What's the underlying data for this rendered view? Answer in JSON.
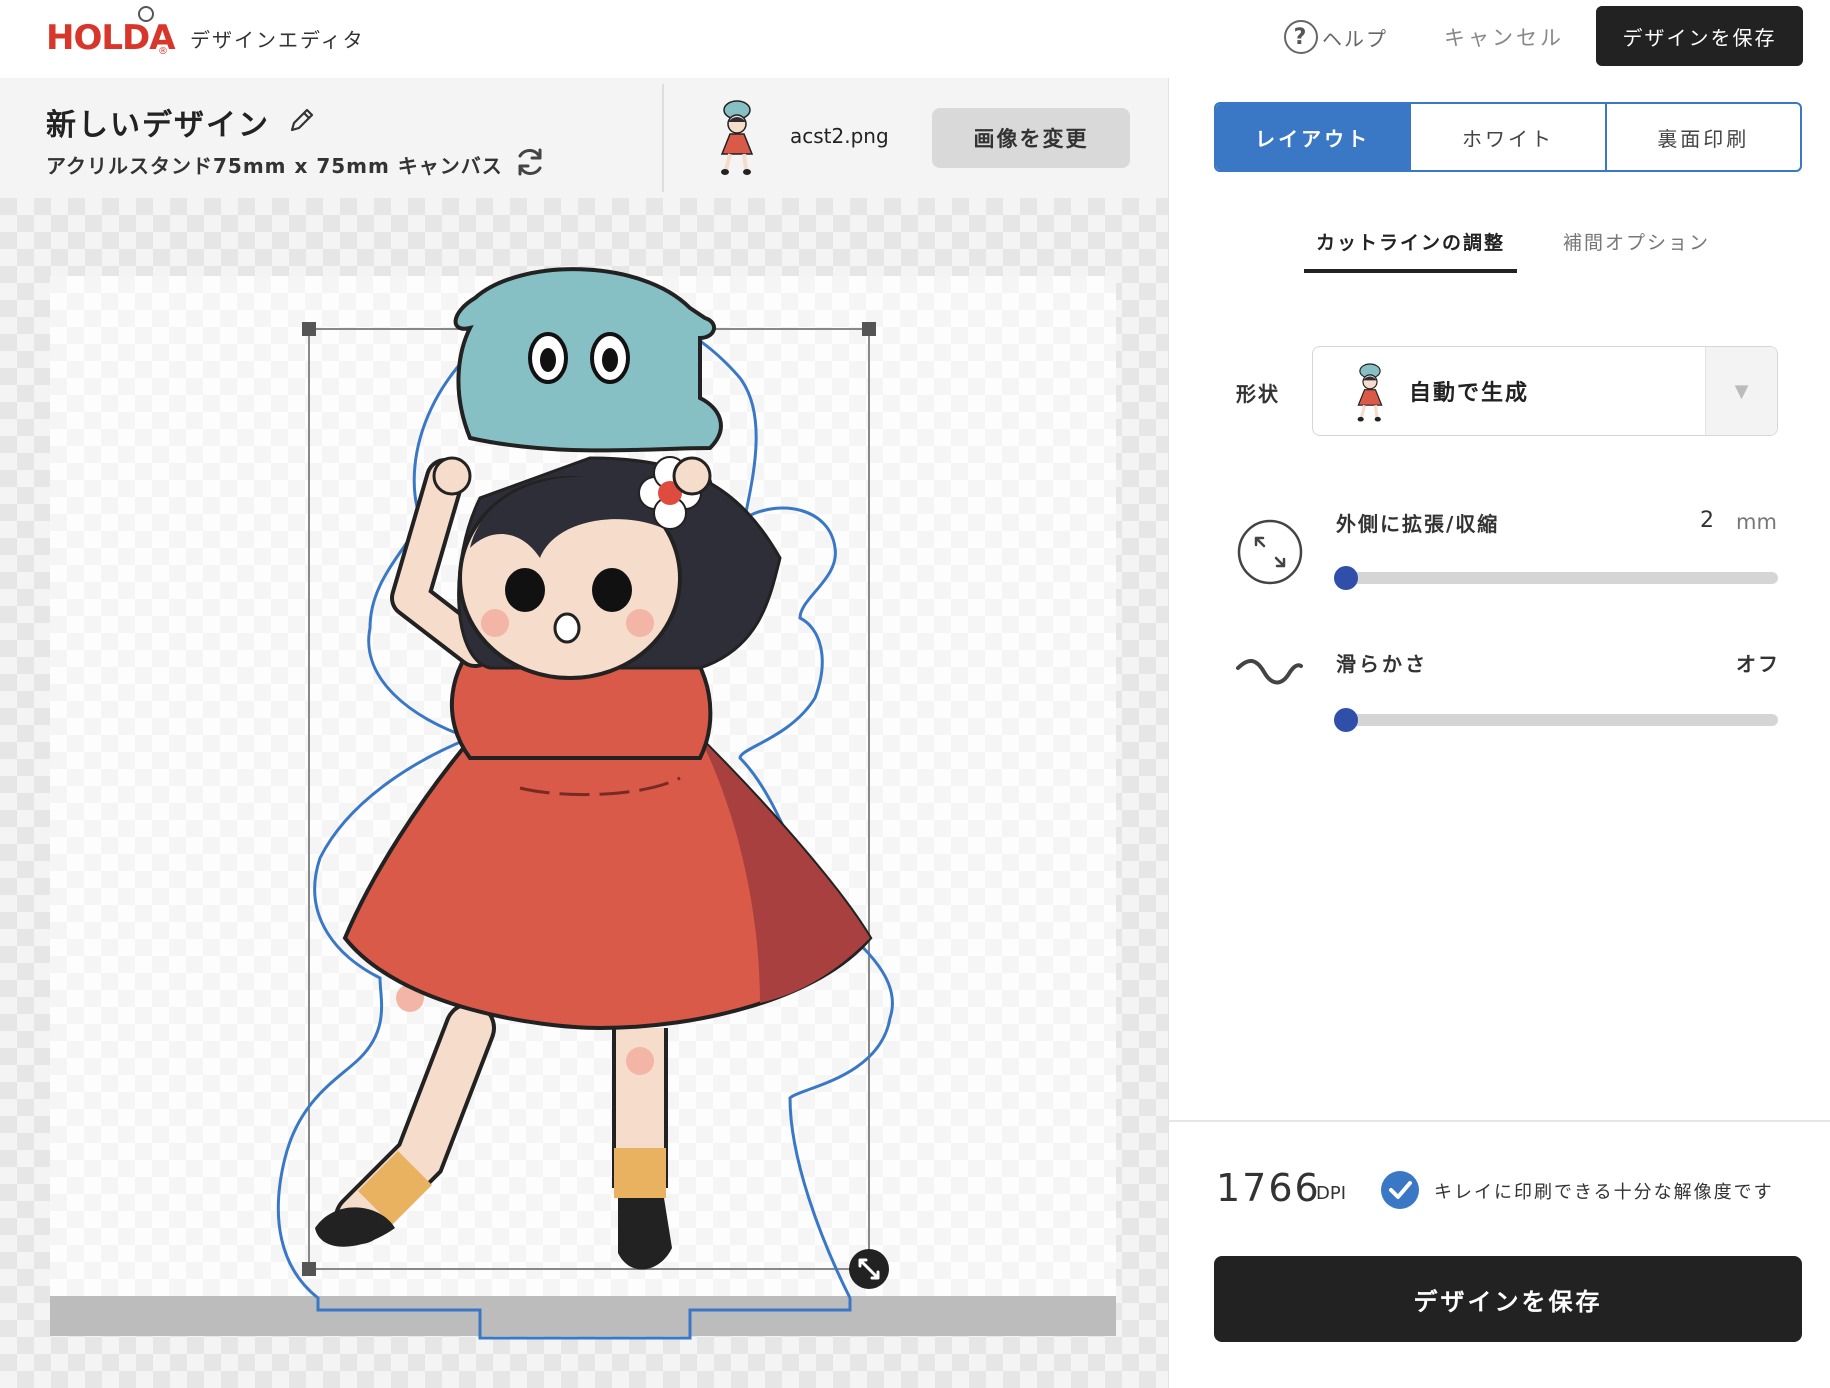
{
  "app": {
    "logo": "HOLDA",
    "subtitle": "デザインエディタ"
  },
  "topbar": {
    "help_label": "ヘルプ",
    "cancel_label": "キャンセル",
    "save_label": "デザインを保存"
  },
  "design": {
    "title": "新しいデザイン",
    "canvas_spec": "アクリルスタンド75mm x 75mm キャンバス",
    "file_name": "acst2.png",
    "change_image_label": "画像を変更"
  },
  "tabs": [
    {
      "label": "レイアウト",
      "active": true
    },
    {
      "label": "ホワイト",
      "active": false
    },
    {
      "label": "裏面印刷",
      "active": false
    }
  ],
  "subtabs": [
    {
      "label": "カットラインの調整",
      "active": true
    },
    {
      "label": "補間オプション",
      "active": false
    }
  ],
  "shape": {
    "label": "形状",
    "value": "自動で生成"
  },
  "expand": {
    "label": "外側に拡張/収縮",
    "value": "2",
    "unit": "mm",
    "slider_fraction": 0.0
  },
  "smoothness": {
    "label": "滑らかさ",
    "value": "オフ",
    "slider_fraction": 0.0
  },
  "resolution": {
    "dpi": "1766",
    "unit": "DPI",
    "message": "キレイに印刷できる十分な解像度です"
  },
  "footer": {
    "save_label": "デザインを保存"
  },
  "colors": {
    "accent": "#3a78c6",
    "slider_thumb": "#2f4fa8",
    "primary_button": "#222222",
    "logo": "#d9362b",
    "cutline": "#3a78c6",
    "dress": "#d95a48",
    "hat": "#86c0c4"
  }
}
